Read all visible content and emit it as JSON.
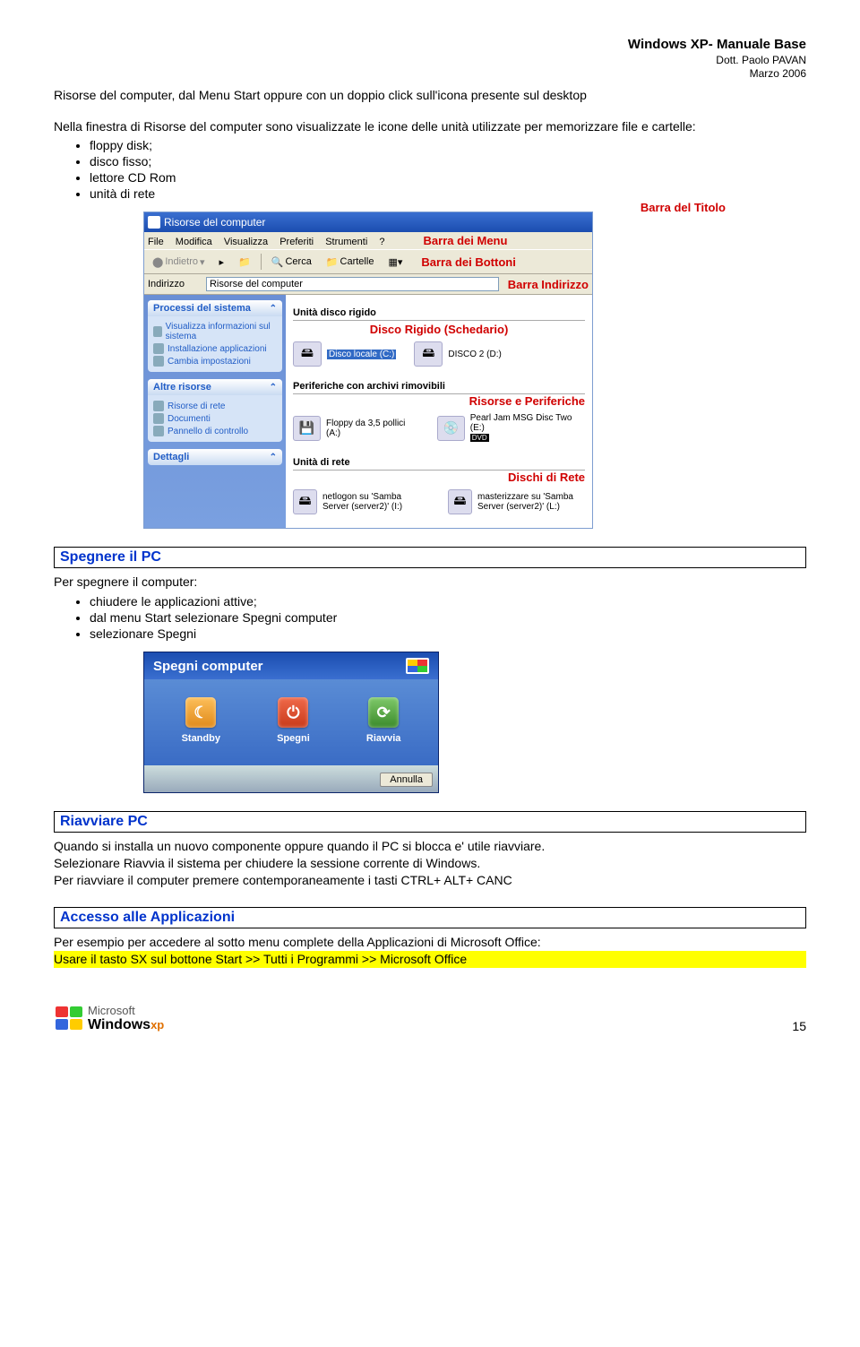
{
  "header": {
    "title": "Windows XP- Manuale Base",
    "author": "Dott. Paolo PAVAN",
    "date": "Marzo 2006"
  },
  "intro": {
    "p1": "Risorse del computer, dal Menu Start oppure con un doppio click sull'icona presente sul desktop",
    "p2": "Nella finestra di Risorse del computer sono visualizzate le icone delle unità utilizzate per memorizzare file e cartelle:",
    "bullets": [
      "floppy disk;",
      "disco fisso;",
      "lettore CD Rom",
      "unità di rete"
    ]
  },
  "shot1": {
    "ann": {
      "titolo": "Barra del Titolo",
      "menu": "Barra dei Menu",
      "bottoni": "Barra dei Bottoni",
      "indirizzo": "Barra Indirizzo",
      "disco": "Disco Rigido (Schedario)",
      "periferiche": "Risorse e Periferiche",
      "rete": "Dischi di Rete"
    },
    "title": "Risorse del computer",
    "menubar": [
      "File",
      "Modifica",
      "Visualizza",
      "Preferiti",
      "Strumenti",
      "?"
    ],
    "toolbar": {
      "back": "Indietro",
      "cerca": "Cerca",
      "cartelle": "Cartelle"
    },
    "address_label": "Indirizzo",
    "address_value": "Risorse del computer",
    "side": {
      "panel1": {
        "title": "Processi del sistema",
        "items": [
          "Visualizza informazioni sul sistema",
          "Installazione applicazioni",
          "Cambia impostazioni"
        ]
      },
      "panel2": {
        "title": "Altre risorse",
        "items": [
          "Risorse di rete",
          "Documenti",
          "Pannello di controllo"
        ]
      },
      "panel3": {
        "title": "Dettagli"
      }
    },
    "main": {
      "g1": {
        "hdr": "Unità disco rigido",
        "d1": "Disco locale (C:)",
        "d2": "DISCO 2 (D:)"
      },
      "g2": {
        "hdr": "Periferiche con archivi rimovibili",
        "d1": "Floppy da 3,5 pollici (A:)",
        "d2": "Pearl Jam MSG Disc Two (E:)",
        "dvd": "DVD"
      },
      "g3": {
        "hdr": "Unità di rete",
        "d1": "netlogon su 'Samba Server (server2)' (I:)",
        "d2": "masterizzare su 'Samba Server (server2)' (L:)"
      }
    }
  },
  "spegnere": {
    "heading": "Spegnere il PC",
    "p": "Per spegnere il computer:",
    "bullets": [
      "chiudere le applicazioni attive;",
      "dal menu Start selezionare Spegni computer",
      "selezionare Spegni"
    ]
  },
  "shot2": {
    "title": "Spegni computer",
    "b1": "Standby",
    "b2": "Spegni",
    "b3": "Riavvia",
    "cancel": "Annulla"
  },
  "riavviare": {
    "heading": "Riavviare PC",
    "p1": "Quando si installa un nuovo componente oppure quando il PC si blocca e' utile riavviare.",
    "p2": "Selezionare Riavvia il sistema per chiudere la sessione corrente di Windows.",
    "p3": "Per riavviare il computer premere contemporaneamente i tasti CTRL+ ALT+ CANC"
  },
  "accesso": {
    "heading": "Accesso alle Applicazioni",
    "p1": "Per esempio per accedere al sotto menu complete della Applicazioni di Microsoft Office:",
    "hl": "Usare il tasto SX sul bottone Start >> Tutti i Programmi >> Microsoft Office"
  },
  "footer": {
    "brand1": "Microsoft",
    "brand2": "Windows",
    "brand3": "xp",
    "page": "15"
  }
}
